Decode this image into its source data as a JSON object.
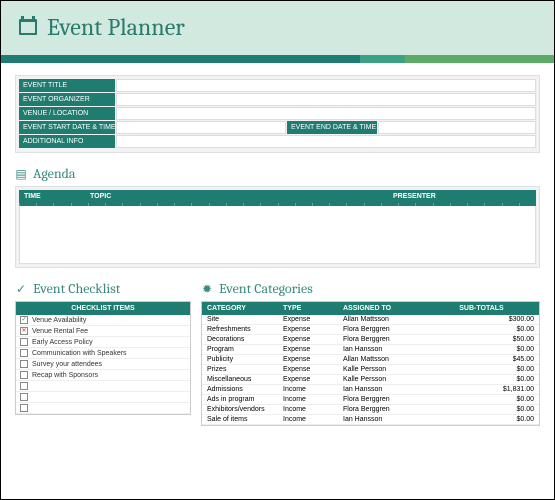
{
  "header": {
    "title": "Event Planner"
  },
  "event_info": {
    "labels": {
      "title": "EVENT TITLE",
      "organizer": "EVENT ORGANIZER",
      "venue": "VENUE / LOCATION",
      "start": "EVENT START DATE & TIME",
      "end": "EVENT END DATE & TIME",
      "additional": "ADDITIONAL INFO"
    },
    "values": {
      "title": "",
      "organizer": "",
      "venue": "",
      "start": "",
      "end": "",
      "additional": ""
    }
  },
  "agenda": {
    "title": "Agenda",
    "headers": {
      "time": "TIME",
      "topic": "TOPIC",
      "presenter": "PRESENTER"
    }
  },
  "checklist": {
    "title": "Event Checklist",
    "header": "CHECKLIST ITEMS",
    "items": [
      {
        "state": "checked",
        "label": "Venue Availability"
      },
      {
        "state": "x",
        "label": "Venue Rental Fee"
      },
      {
        "state": "",
        "label": "Early Access Policy"
      },
      {
        "state": "",
        "label": "Communication with Speakers"
      },
      {
        "state": "",
        "label": "Survey your attendees"
      },
      {
        "state": "",
        "label": "Recap with Sponsors"
      },
      {
        "state": "",
        "label": ""
      },
      {
        "state": "",
        "label": ""
      },
      {
        "state": "",
        "label": ""
      }
    ]
  },
  "categories": {
    "title": "Event Categories",
    "headers": {
      "category": "CATEGORY",
      "type": "TYPE",
      "assigned": "ASSIGNED TO",
      "sub": "SUB-TOTALS"
    },
    "rows": [
      {
        "category": "Site",
        "type": "Expense",
        "assigned": "Allan Mattsson",
        "sub": "$300.00"
      },
      {
        "category": "Refreshments",
        "type": "Expense",
        "assigned": "Flora Berggren",
        "sub": "$0.00"
      },
      {
        "category": "Decorations",
        "type": "Expense",
        "assigned": "Flora Berggren",
        "sub": "$50.00"
      },
      {
        "category": "Program",
        "type": "Expense",
        "assigned": "Ian Hansson",
        "sub": "$0.00"
      },
      {
        "category": "Publicity",
        "type": "Expense",
        "assigned": "Allan Mattsson",
        "sub": "$45.00"
      },
      {
        "category": "Prizes",
        "type": "Expense",
        "assigned": "Kalle Persson",
        "sub": "$0.00"
      },
      {
        "category": "Miscellaneous",
        "type": "Expense",
        "assigned": "Kalle Persson",
        "sub": "$0.00"
      },
      {
        "category": "Admissions",
        "type": "Income",
        "assigned": "Ian Hansson",
        "sub": "$1,831.00"
      },
      {
        "category": "Ads in program",
        "type": "Income",
        "assigned": "Flora Berggren",
        "sub": "$0.00"
      },
      {
        "category": "Exhibitors/vendors",
        "type": "Income",
        "assigned": "Flora Berggren",
        "sub": "$0.00"
      },
      {
        "category": "Sale of items",
        "type": "Income",
        "assigned": "Ian Hansson",
        "sub": "$0.00"
      }
    ]
  }
}
